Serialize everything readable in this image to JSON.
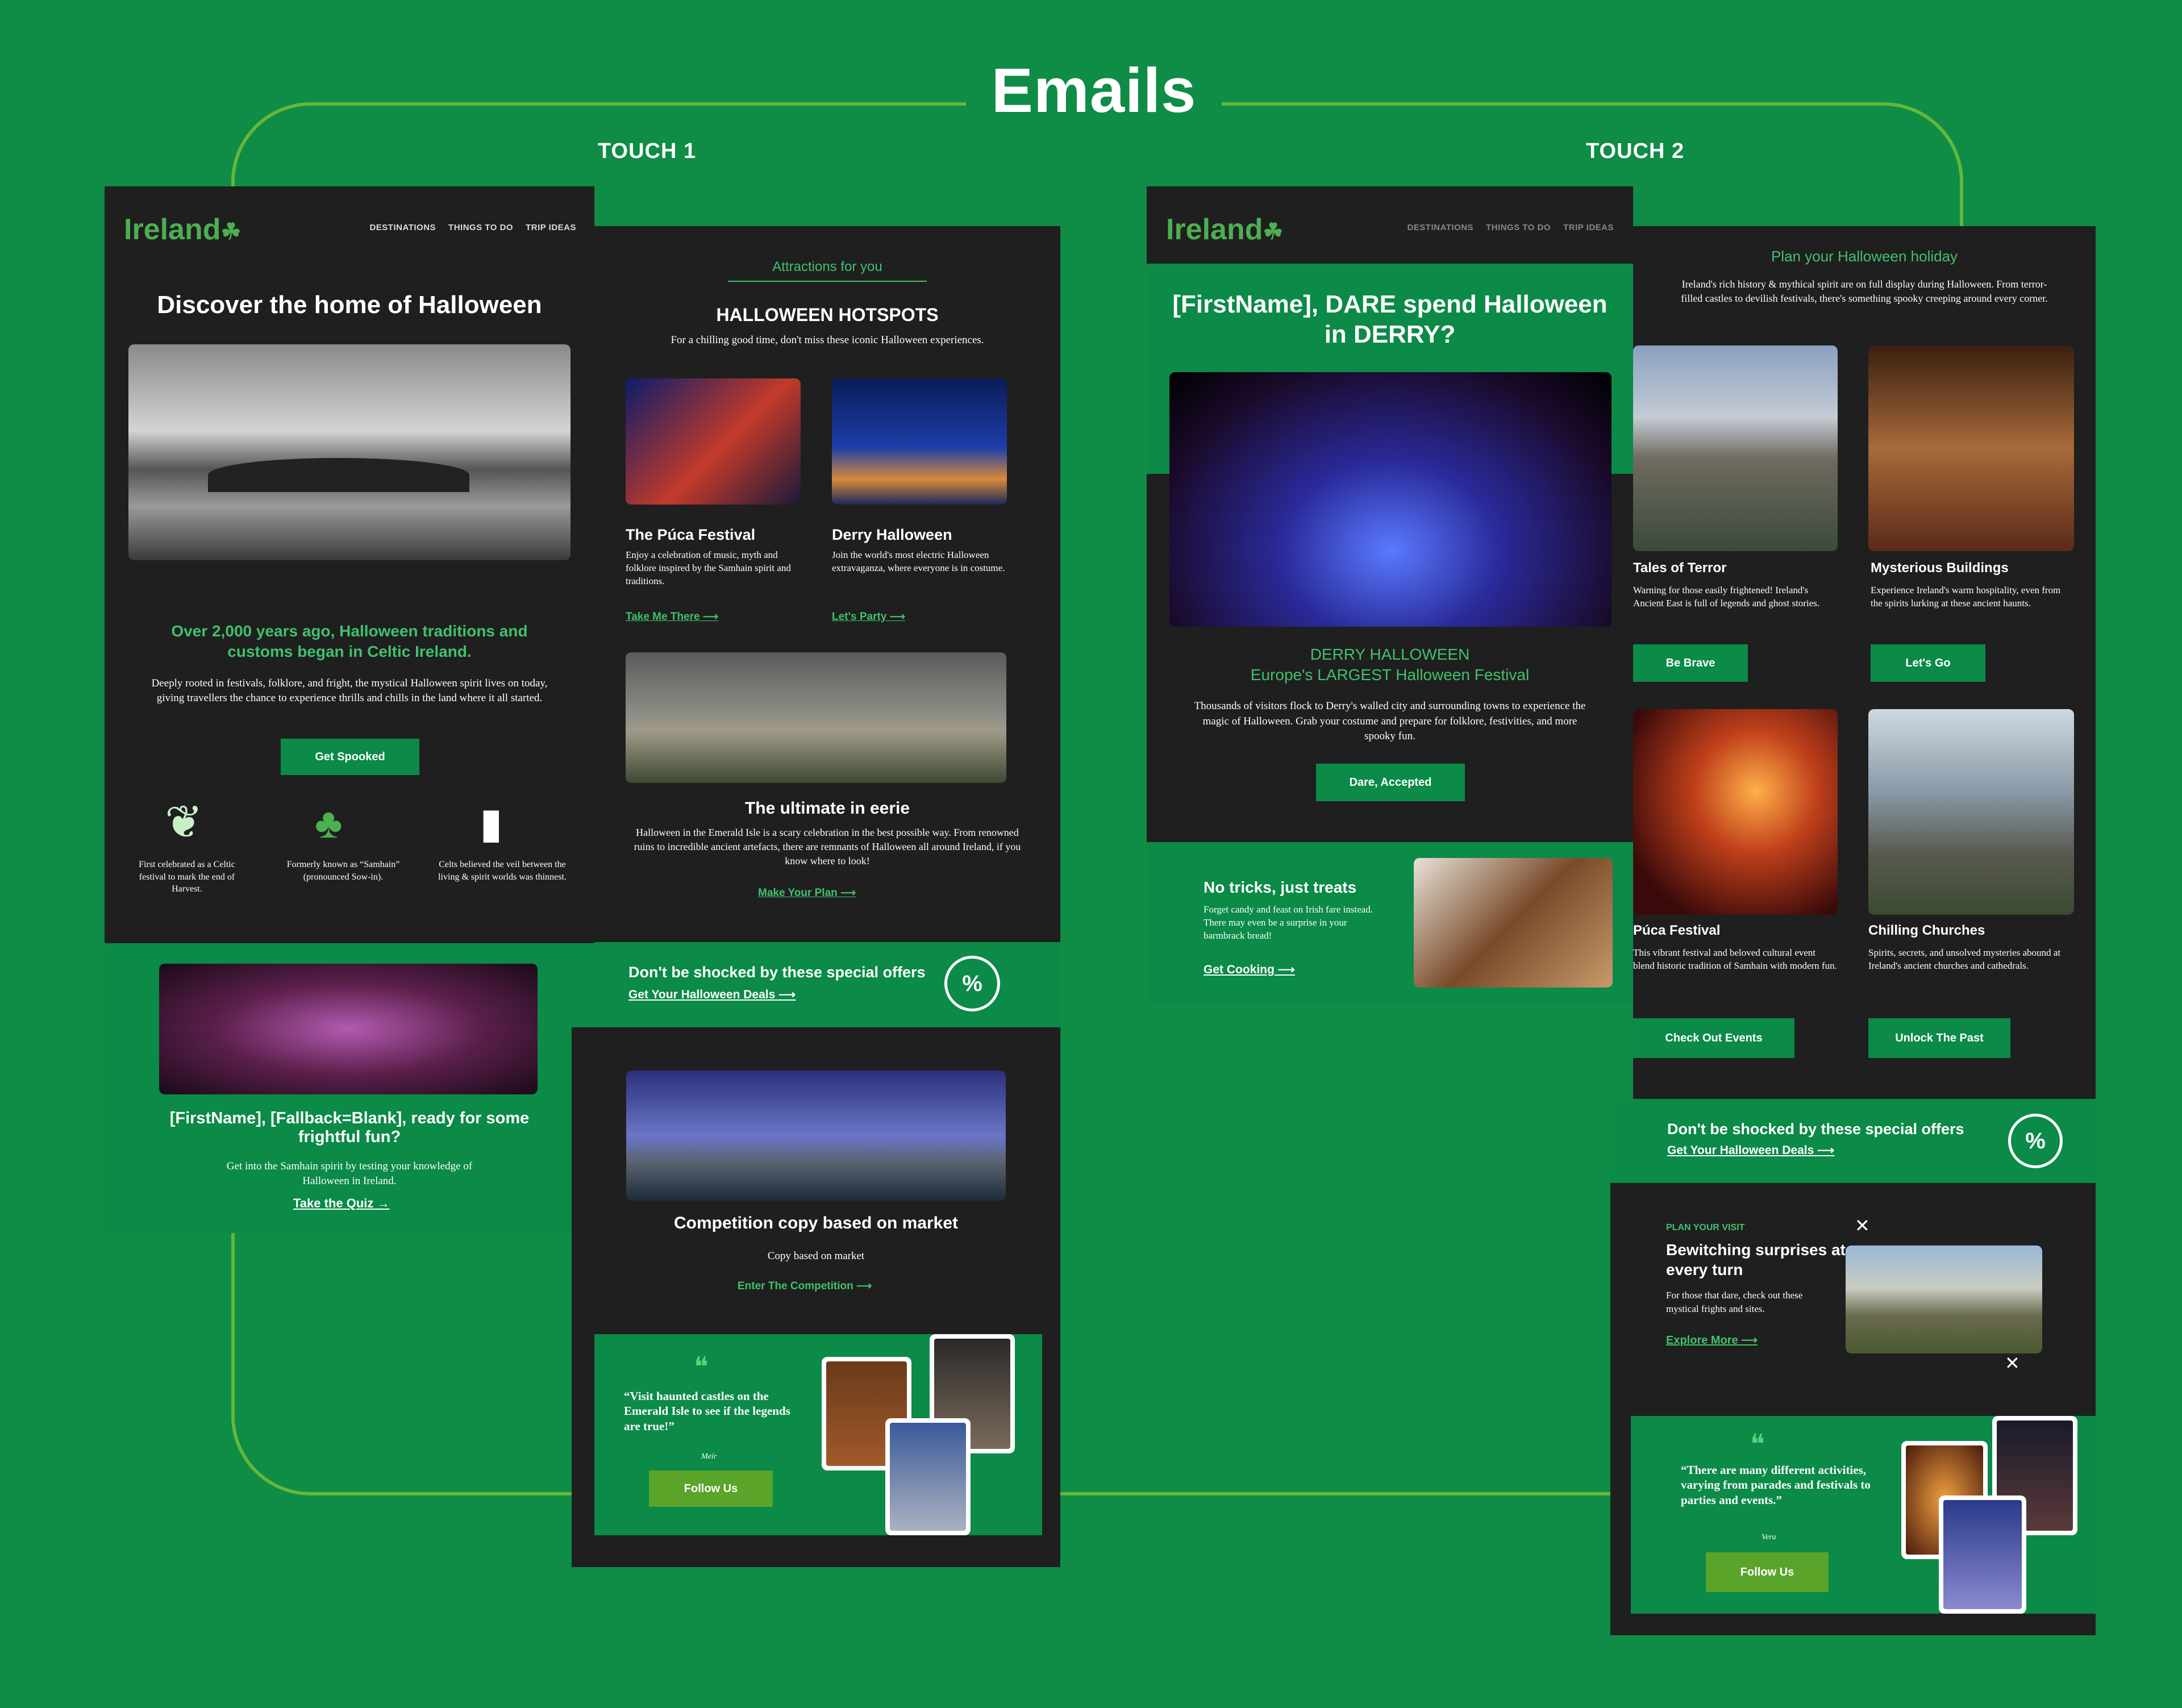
{
  "page": {
    "title": "Emails",
    "touch1": "TOUCH 1",
    "touch2": "TOUCH 2"
  },
  "e1": {
    "logo": "Ireland",
    "nav": [
      "DESTINATIONS",
      "THINGS TO DO",
      "TRIP IDEAS"
    ],
    "headline": "Discover the home of Halloween",
    "subhead": "Over 2,000 years ago, Halloween traditions and customs began in Celtic Ireland.",
    "body": "Deeply rooted in festivals, folklore, and fright, the mystical Halloween spirit lives on today, giving travellers the chance to experience thrills and chills in the land where it all started.",
    "cta": "Get Spooked",
    "facts": [
      "First celebrated as a Celtic festival to mark the end of Harvest.",
      "Formerly known as “Samhain” (pronounced Sow-in).",
      "Celts believed the veil between the living & spirit worlds was thinnest."
    ],
    "quiz_title": "[FirstName], [Fallback=Blank], ready for some frightful fun?",
    "quiz_body": "Get into the Samhain spirit by testing your knowledge of Halloween in Ireland.",
    "quiz_link": "Take the Quiz"
  },
  "e2": {
    "eyebrow": "Attractions for you",
    "title": "HALLOWEEN HOTSPOTS",
    "intro": "For a chilling good time, don't miss these iconic Halloween experiences.",
    "cards": [
      {
        "title": "The Púca Festival",
        "body": "Enjoy a celebration of music, myth and folklore inspired by the Samhain spirit and traditions.",
        "link": "Take Me There"
      },
      {
        "title": "Derry Halloween",
        "body": "Join the world's most electric Halloween extravaganza, where everyone is in costume.",
        "link": "Let's Party"
      }
    ],
    "feature_title": "The ultimate in eerie",
    "feature_body": "Halloween in the Emerald Isle is a scary celebration in the best possible way. From renowned ruins to incredible ancient artefacts, there are remnants of Halloween all around Ireland, if you know where to look!",
    "feature_link": "Make Your Plan",
    "offer": "Don't be shocked by these special offers",
    "offer_link": "Get Your Halloween Deals",
    "pct": "%",
    "comp_title": "Competition copy based on market",
    "comp_body": "Copy based on market",
    "comp_link": "Enter The Competition",
    "quote": "“Visit haunted castles on the Emerald Isle to see if the legends are true!”",
    "quote_author": "Meír",
    "follow": "Follow Us"
  },
  "e3": {
    "logo": "Ireland",
    "nav": [
      "DESTINATIONS",
      "THINGS TO DO",
      "TRIP IDEAS"
    ],
    "headline": "[FirstName], DARE spend Halloween in DERRY?",
    "sub1": "DERRY HALLOWEEN",
    "sub2": "Europe's LARGEST Halloween Festival",
    "body": "Thousands of visitors flock to Derry's walled city and surrounding towns to experience the magic of Halloween. Grab your costume and prepare for folklore, festivities, and more spooky fun.",
    "cta": "Dare, Accepted",
    "treats_title": "No tricks, just treats",
    "treats_body": "Forget candy and feast on Irish fare instead. There may even be a surprise in your barmbrack bread!",
    "treats_link": "Get Cooking"
  },
  "e4": {
    "eyebrow": "Plan your Halloween holiday",
    "intro": "Ireland's rich history & mythical spirit are on full display during Halloween. From terror-filled castles to devilish festivals, there's something spooky creeping around every corner.",
    "cards": [
      {
        "title": "Tales of Terror",
        "body": "Warning for those easily frightened! Ireland's Ancient East is full of legends and ghost stories.",
        "btn": "Be Brave"
      },
      {
        "title": "Mysterious Buildings",
        "body": "Experience Ireland's warm hospitality, even from the spirits lurking at these ancient haunts.",
        "btn": "Let's Go"
      },
      {
        "title": "Púca Festival",
        "body": "This vibrant festival and beloved cultural event blend historic tradition of Samhain with modern fun.",
        "btn": "Check Out Events"
      },
      {
        "title": "Chilling Churches",
        "body": "Spirits, secrets, and unsolved mysteries abound at Ireland's ancient churches and cathedrals.",
        "btn": "Unlock The Past"
      }
    ],
    "offer": "Don't be shocked by these special offers",
    "offer_link": "Get Your Halloween Deals",
    "pct": "%",
    "plan_eyebrow": "PLAN YOUR VISIT",
    "plan_title": "Bewitching surprises at every turn",
    "plan_body": "For those that dare, check out these mystical frights and sites.",
    "plan_link": "Explore More",
    "quote": "“There are many different activities, varying from parades and festivals to parties and events.”",
    "quote_author": "Vera",
    "follow": "Follow Us"
  },
  "colors": {
    "bg": "#0f8c46",
    "dark": "#1f1f1f",
    "green": "#0b8a48",
    "accent": "#3fc26c",
    "lime": "#5aa42a"
  }
}
